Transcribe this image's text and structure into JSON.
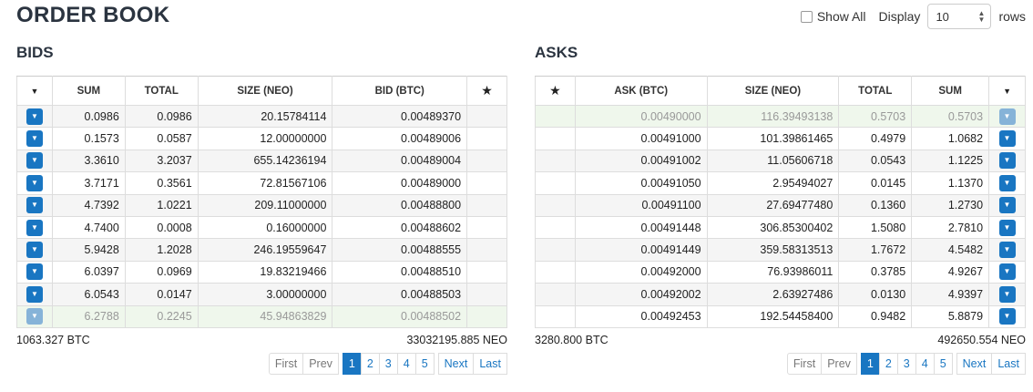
{
  "page": {
    "title": "ORDER BOOK",
    "show_all_label": "Show All",
    "display_label": "Display",
    "display_value": "10",
    "rows_label": "rows"
  },
  "bids": {
    "title": "BIDS",
    "headers": {
      "sum": "SUM",
      "total": "TOTAL",
      "size": "SIZE (NEO)",
      "price": "BID (BTC)"
    },
    "rows": [
      {
        "sum": "0.0986",
        "total": "0.0986",
        "size": "20.15784114",
        "price": "0.00489370"
      },
      {
        "sum": "0.1573",
        "total": "0.0587",
        "size": "12.00000000",
        "price": "0.00489006"
      },
      {
        "sum": "3.3610",
        "total": "3.2037",
        "size": "655.14236194",
        "price": "0.00489004"
      },
      {
        "sum": "3.7171",
        "total": "0.3561",
        "size": "72.81567106",
        "price": "0.00489000"
      },
      {
        "sum": "4.7392",
        "total": "1.0221",
        "size": "209.11000000",
        "price": "0.00488800"
      },
      {
        "sum": "4.7400",
        "total": "0.0008",
        "size": "0.16000000",
        "price": "0.00488602"
      },
      {
        "sum": "5.9428",
        "total": "1.2028",
        "size": "246.19559647",
        "price": "0.00488555"
      },
      {
        "sum": "6.0397",
        "total": "0.0969",
        "size": "19.83219466",
        "price": "0.00488510"
      },
      {
        "sum": "6.0543",
        "total": "0.0147",
        "size": "3.00000000",
        "price": "0.00488503"
      },
      {
        "sum": "6.2788",
        "total": "0.2245",
        "size": "45.94863829",
        "price": "0.00488502"
      }
    ],
    "total_btc": "1063.327 BTC",
    "total_neo": "33032195.885 NEO",
    "pager": {
      "first": "First",
      "prev": "Prev",
      "pages": [
        "1",
        "2",
        "3",
        "4",
        "5"
      ],
      "next": "Next",
      "last": "Last"
    }
  },
  "asks": {
    "title": "ASKS",
    "headers": {
      "price": "ASK (BTC)",
      "size": "SIZE (NEO)",
      "total": "TOTAL",
      "sum": "SUM"
    },
    "rows": [
      {
        "price": "0.00490000",
        "size": "116.39493138",
        "total": "0.5703",
        "sum": "0.5703"
      },
      {
        "price": "0.00491000",
        "size": "101.39861465",
        "total": "0.4979",
        "sum": "1.0682"
      },
      {
        "price": "0.00491002",
        "size": "11.05606718",
        "total": "0.0543",
        "sum": "1.1225"
      },
      {
        "price": "0.00491050",
        "size": "2.95494027",
        "total": "0.0145",
        "sum": "1.1370"
      },
      {
        "price": "0.00491100",
        "size": "27.69477480",
        "total": "0.1360",
        "sum": "1.2730"
      },
      {
        "price": "0.00491448",
        "size": "306.85300402",
        "total": "1.5080",
        "sum": "2.7810"
      },
      {
        "price": "0.00491449",
        "size": "359.58313513",
        "total": "1.7672",
        "sum": "4.5482"
      },
      {
        "price": "0.00492000",
        "size": "76.93986011",
        "total": "0.3785",
        "sum": "4.9267"
      },
      {
        "price": "0.00492002",
        "size": "2.63927486",
        "total": "0.0130",
        "sum": "4.9397"
      },
      {
        "price": "0.00492453",
        "size": "192.54458400",
        "total": "0.9482",
        "sum": "5.8879"
      }
    ],
    "total_btc": "3280.800 BTC",
    "total_neo": "492650.554 NEO",
    "pager": {
      "first": "First",
      "prev": "Prev",
      "pages": [
        "1",
        "2",
        "3",
        "4",
        "5"
      ],
      "next": "Next",
      "last": "Last"
    }
  },
  "icons": {
    "row_action": "chevron-down-icon",
    "sort": "caret-down-icon",
    "favorite": "star-icon"
  },
  "colors": {
    "accent": "#1976c2",
    "highlight_row": "#eff7ec",
    "title": "#2b3440"
  }
}
